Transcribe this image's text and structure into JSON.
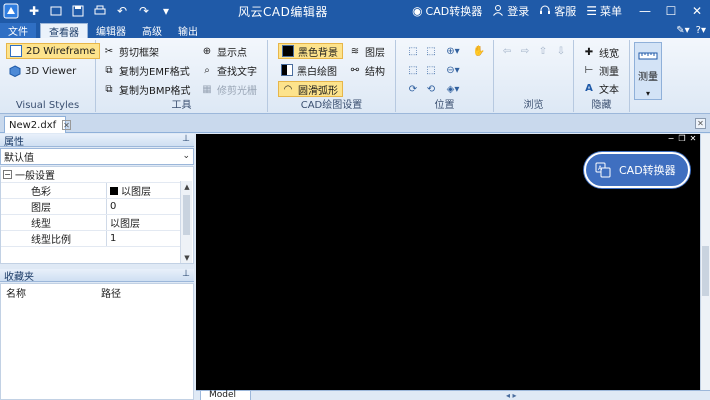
{
  "window": {
    "title": "风云CAD编辑器",
    "links": [
      {
        "icon": "cad-logo-icon",
        "label": "CAD转换器"
      },
      {
        "icon": "user-icon",
        "label": "登录"
      },
      {
        "icon": "headset-icon",
        "label": "客服"
      },
      {
        "icon": "menu-icon",
        "label": "菜单"
      }
    ]
  },
  "ribbon_tabs": [
    "文件",
    "查看器",
    "编辑器",
    "高级",
    "输出"
  ],
  "active_tab": "查看器",
  "ribbon": {
    "visual_styles": {
      "label": "Visual Styles",
      "items": [
        "2D Wireframe",
        "3D Viewer"
      ]
    },
    "tools": {
      "label": "工具",
      "items": [
        "剪切框架",
        "复制为EMF格式",
        "复制为BMP格式",
        "显示点",
        "查找文字",
        "修剪光栅"
      ]
    },
    "cad_settings": {
      "label": "CAD绘图设置",
      "items": [
        "黑色背景",
        "黑白绘图",
        "圆滑弧形",
        "图层",
        "结构"
      ]
    },
    "position": {
      "label": "位置"
    },
    "browse": {
      "label": "浏览"
    },
    "hide": {
      "label": "隐藏",
      "items": [
        "线宽",
        "测量",
        "文本"
      ]
    },
    "measure": {
      "label": "测量"
    }
  },
  "document_tab": "New2.dxf",
  "properties": {
    "title": "属性",
    "selected": "默认值",
    "group": "一般设置",
    "rows": [
      {
        "key": "色彩",
        "value": "以图层"
      },
      {
        "key": "图层",
        "value": "0"
      },
      {
        "key": "线型",
        "value": "以图层"
      },
      {
        "key": "线型比例",
        "value": "1"
      }
    ]
  },
  "favorites": {
    "title": "收藏夹",
    "columns": [
      "名称",
      "路径"
    ]
  },
  "converter_button": "CAD转换器",
  "layout_tab": "Model",
  "colors": {
    "titlebar": "#1f5aa8",
    "accent_button": "#3f6fc0",
    "canvas": "#000000"
  }
}
